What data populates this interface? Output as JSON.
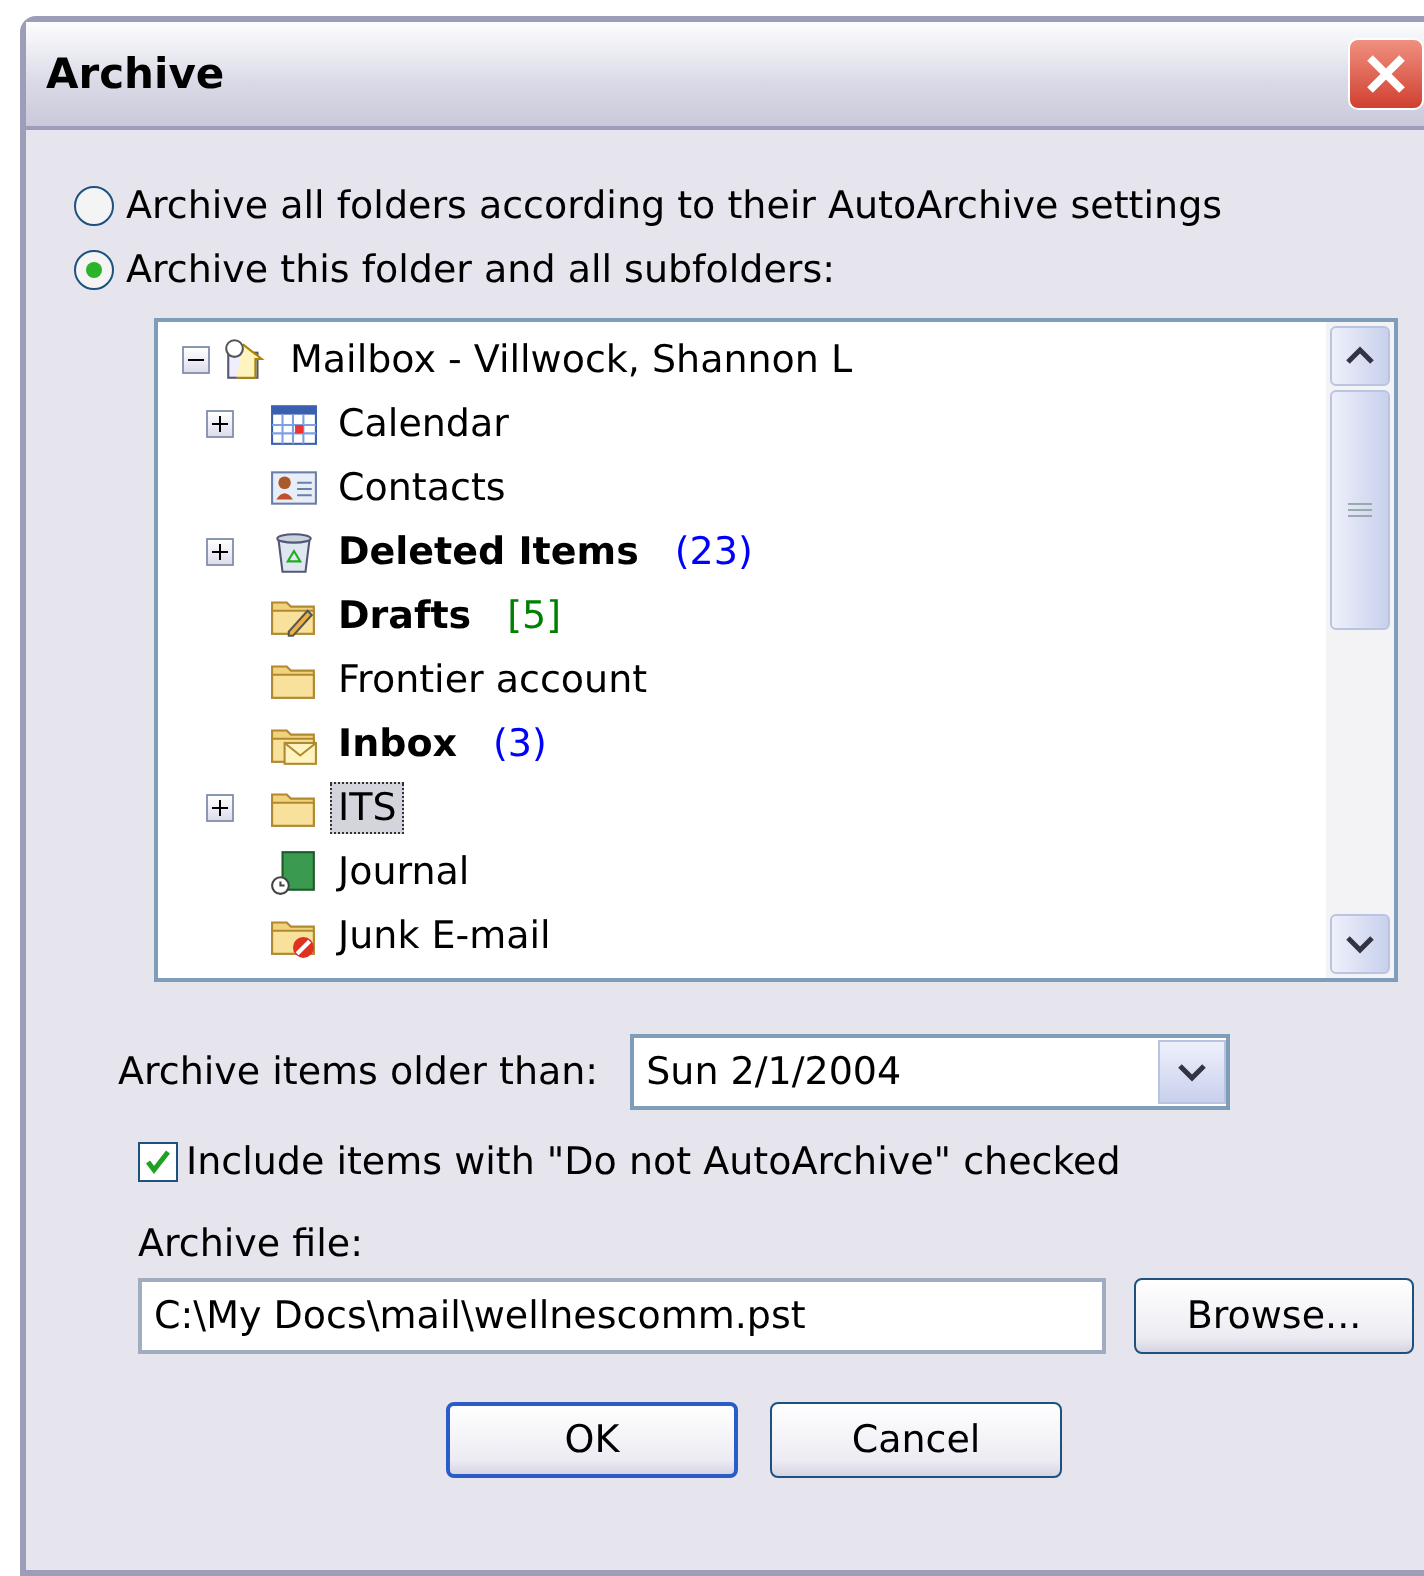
{
  "window": {
    "title": "Archive"
  },
  "options": [
    {
      "label": "Archive all folders according to their AutoArchive settings",
      "selected": false
    },
    {
      "label": "Archive this folder and all subfolders:",
      "selected": true
    }
  ],
  "tree": {
    "label": "Mailbox - Villwock, Shannon L",
    "expanded": true,
    "kind": "mailbox",
    "children": [
      {
        "label": "Calendar",
        "kind": "calendar",
        "has_children": true,
        "bold": false,
        "selected": false
      },
      {
        "label": "Contacts",
        "kind": "contacts",
        "has_children": false,
        "bold": false,
        "selected": false
      },
      {
        "label": "Deleted Items",
        "kind": "trash",
        "has_children": true,
        "bold": true,
        "count": "(23)",
        "color": "#0000ff",
        "selected": false
      },
      {
        "label": "Drafts",
        "kind": "drafts",
        "has_children": false,
        "bold": true,
        "count": "[5]",
        "color": "#008000",
        "selected": false
      },
      {
        "label": "Frontier account",
        "kind": "folder",
        "has_children": false,
        "bold": false,
        "selected": false
      },
      {
        "label": "Inbox",
        "kind": "inbox",
        "has_children": false,
        "bold": true,
        "count": "(3)",
        "color": "#0000ff",
        "selected": false
      },
      {
        "label": "ITS",
        "kind": "folder",
        "has_children": true,
        "bold": false,
        "selected": true
      },
      {
        "label": "Journal",
        "kind": "journal",
        "has_children": false,
        "bold": false,
        "selected": false
      },
      {
        "label": "Junk E-mail",
        "kind": "junk",
        "has_children": false,
        "bold": false,
        "selected": false
      }
    ]
  },
  "older_than": {
    "label": "Archive items older than:",
    "value": "Sun 2/1/2004"
  },
  "include": {
    "label": "Include items with \"Do not AutoArchive\" checked",
    "checked": true
  },
  "archive_file": {
    "label": "Archive file:",
    "value": "C:\\My Docs\\mail\\wellnescomm.pst",
    "browse": "Browse..."
  },
  "buttons": [
    "OK",
    "Cancel"
  ]
}
